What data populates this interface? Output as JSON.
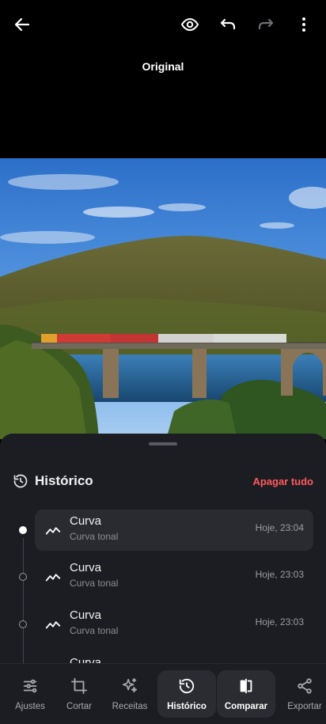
{
  "header": {
    "back_icon": "arrow-left-icon",
    "actions": [
      "eye-icon",
      "undo-icon",
      "redo-icon",
      "more-vert-icon"
    ],
    "view_label": "Original"
  },
  "history": {
    "title": "Histórico",
    "clear_all": "Apagar tudo",
    "items": [
      {
        "title": "Curva",
        "subtitle": "Curva tonal",
        "time": "Hoje, 23:04",
        "active": true
      },
      {
        "title": "Curva",
        "subtitle": "Curva tonal",
        "time": "Hoje, 23:03",
        "active": false
      },
      {
        "title": "Curva",
        "subtitle": "Curva tonal",
        "time": "Hoje, 23:03",
        "active": false
      },
      {
        "title": "Curva",
        "subtitle": "",
        "time": "",
        "active": false
      }
    ]
  },
  "nav": {
    "items": [
      {
        "label": "Ajustes",
        "icon": "sliders-icon"
      },
      {
        "label": "Cortar",
        "icon": "crop-icon"
      },
      {
        "label": "Receitas",
        "icon": "sparkles-icon"
      },
      {
        "label": "Histórico",
        "icon": "history-icon",
        "selected": true
      },
      {
        "label": "Comparar",
        "icon": "compare-icon",
        "selected": true
      },
      {
        "label": "Exportar",
        "icon": "share-icon"
      }
    ]
  },
  "colors": {
    "accent_red": "#ff5a5f",
    "sheet_bg": "#1c1d22"
  }
}
